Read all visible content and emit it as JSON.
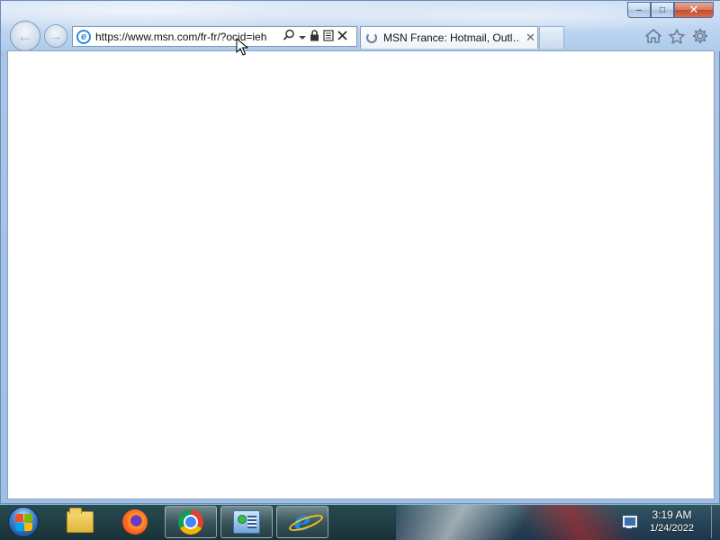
{
  "browser": {
    "address_bar": {
      "url": "https://www.msn.com/fr-fr/?ocid=ieh"
    },
    "tab": {
      "title": "MSN France: Hotmail, Outl…"
    },
    "caption_buttons": {
      "minimize": "–",
      "maximize": "□",
      "close": "✕"
    },
    "toolbar_icons": [
      "home-icon",
      "favorites-star-icon",
      "tools-gear-icon"
    ]
  },
  "taskbar": {
    "pinned_items": [
      {
        "name": "windows-explorer",
        "icon": "folder-icon"
      },
      {
        "name": "firefox",
        "icon": "firefox-icon"
      },
      {
        "name": "chrome",
        "icon": "chrome-icon"
      },
      {
        "name": "control-panel",
        "icon": "control-panel-icon"
      },
      {
        "name": "internet-explorer",
        "icon": "ie-icon",
        "active": true
      }
    ],
    "clock": {
      "time": "3:19 AM",
      "date": "1/24/2022"
    }
  }
}
